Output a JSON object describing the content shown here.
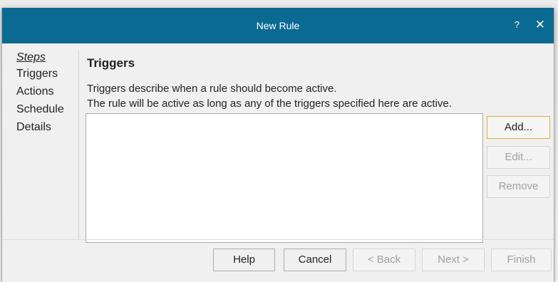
{
  "window": {
    "title": "New Rule",
    "help_glyph": "?",
    "close_glyph": "✕"
  },
  "sidebar": {
    "heading": "Steps",
    "items": [
      {
        "label": "Triggers"
      },
      {
        "label": "Actions"
      },
      {
        "label": "Schedule"
      },
      {
        "label": "Details"
      }
    ]
  },
  "main": {
    "title": "Triggers",
    "description_line1": "Triggers describe when a rule should become active.",
    "description_line2": "The rule will be active as long as any of the triggers specified here are active."
  },
  "side_buttons": {
    "add": "Add...",
    "edit": "Edit...",
    "remove": "Remove"
  },
  "footer": {
    "help": "Help",
    "cancel": "Cancel",
    "back": "< Back",
    "next": "Next >",
    "finish": "Finish"
  },
  "colors": {
    "titlebar": "#0a6a92",
    "default_button_border": "#d6b43b"
  }
}
